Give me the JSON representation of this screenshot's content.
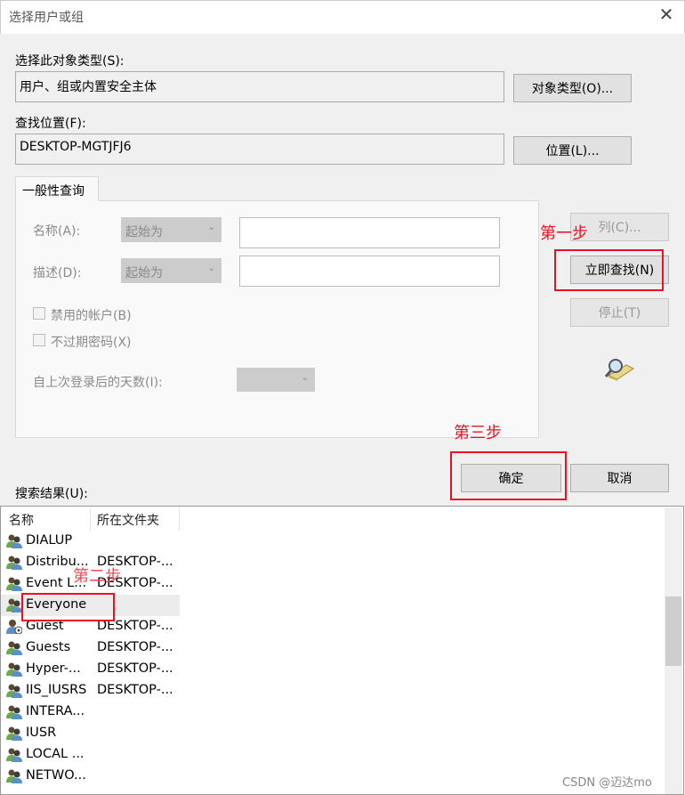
{
  "dialog": {
    "title": "选择用户或组",
    "close": "✕"
  },
  "object_type": {
    "label": "选择此对象类型(S):",
    "value": "用户、组或内置安全主体",
    "button": "对象类型(O)..."
  },
  "location": {
    "label": "查找位置(F):",
    "value": "DESKTOP-MGTJFJ6",
    "button": "位置(L)..."
  },
  "query": {
    "tab": "一般性查询",
    "name_label": "名称(A):",
    "name_mode": "起始为",
    "name_value": "",
    "desc_label": "描述(D):",
    "desc_mode": "起始为",
    "desc_value": "",
    "disabled_accounts": "禁用的帐户(B)",
    "non_expiring": "不过期密码(X)",
    "days_label": "自上次登录后的天数(I):",
    "days_value": ""
  },
  "buttons": {
    "columns": "列(C)...",
    "find_now": "立即查找(N)",
    "stop": "停止(T)",
    "ok": "确定",
    "cancel": "取消"
  },
  "annotations": {
    "step1": "第一步",
    "step2": "第二步",
    "step3": "第三步"
  },
  "results": {
    "label": "搜索结果(U):",
    "columns": [
      "名称",
      "所在文件夹"
    ],
    "rows": [
      {
        "name": "DIALUP",
        "folder": "",
        "icon": "group"
      },
      {
        "name": "Distribu...",
        "folder": "DESKTOP-...",
        "icon": "group"
      },
      {
        "name": "Event L...",
        "folder": "DESKTOP-...",
        "icon": "group"
      },
      {
        "name": "Everyone",
        "folder": "",
        "icon": "group",
        "selected": true
      },
      {
        "name": "Guest",
        "folder": "DESKTOP-...",
        "icon": "user-disabled"
      },
      {
        "name": "Guests",
        "folder": "DESKTOP-...",
        "icon": "group"
      },
      {
        "name": "Hyper-...",
        "folder": "DESKTOP-...",
        "icon": "group"
      },
      {
        "name": "IIS_IUSRS",
        "folder": "DESKTOP-...",
        "icon": "group"
      },
      {
        "name": "INTERA...",
        "folder": "",
        "icon": "group"
      },
      {
        "name": "IUSR",
        "folder": "",
        "icon": "group"
      },
      {
        "name": "LOCAL ...",
        "folder": "",
        "icon": "group"
      },
      {
        "name": "NETWO...",
        "folder": "",
        "icon": "group"
      }
    ]
  },
  "watermark": "CSDN @迈达mo"
}
